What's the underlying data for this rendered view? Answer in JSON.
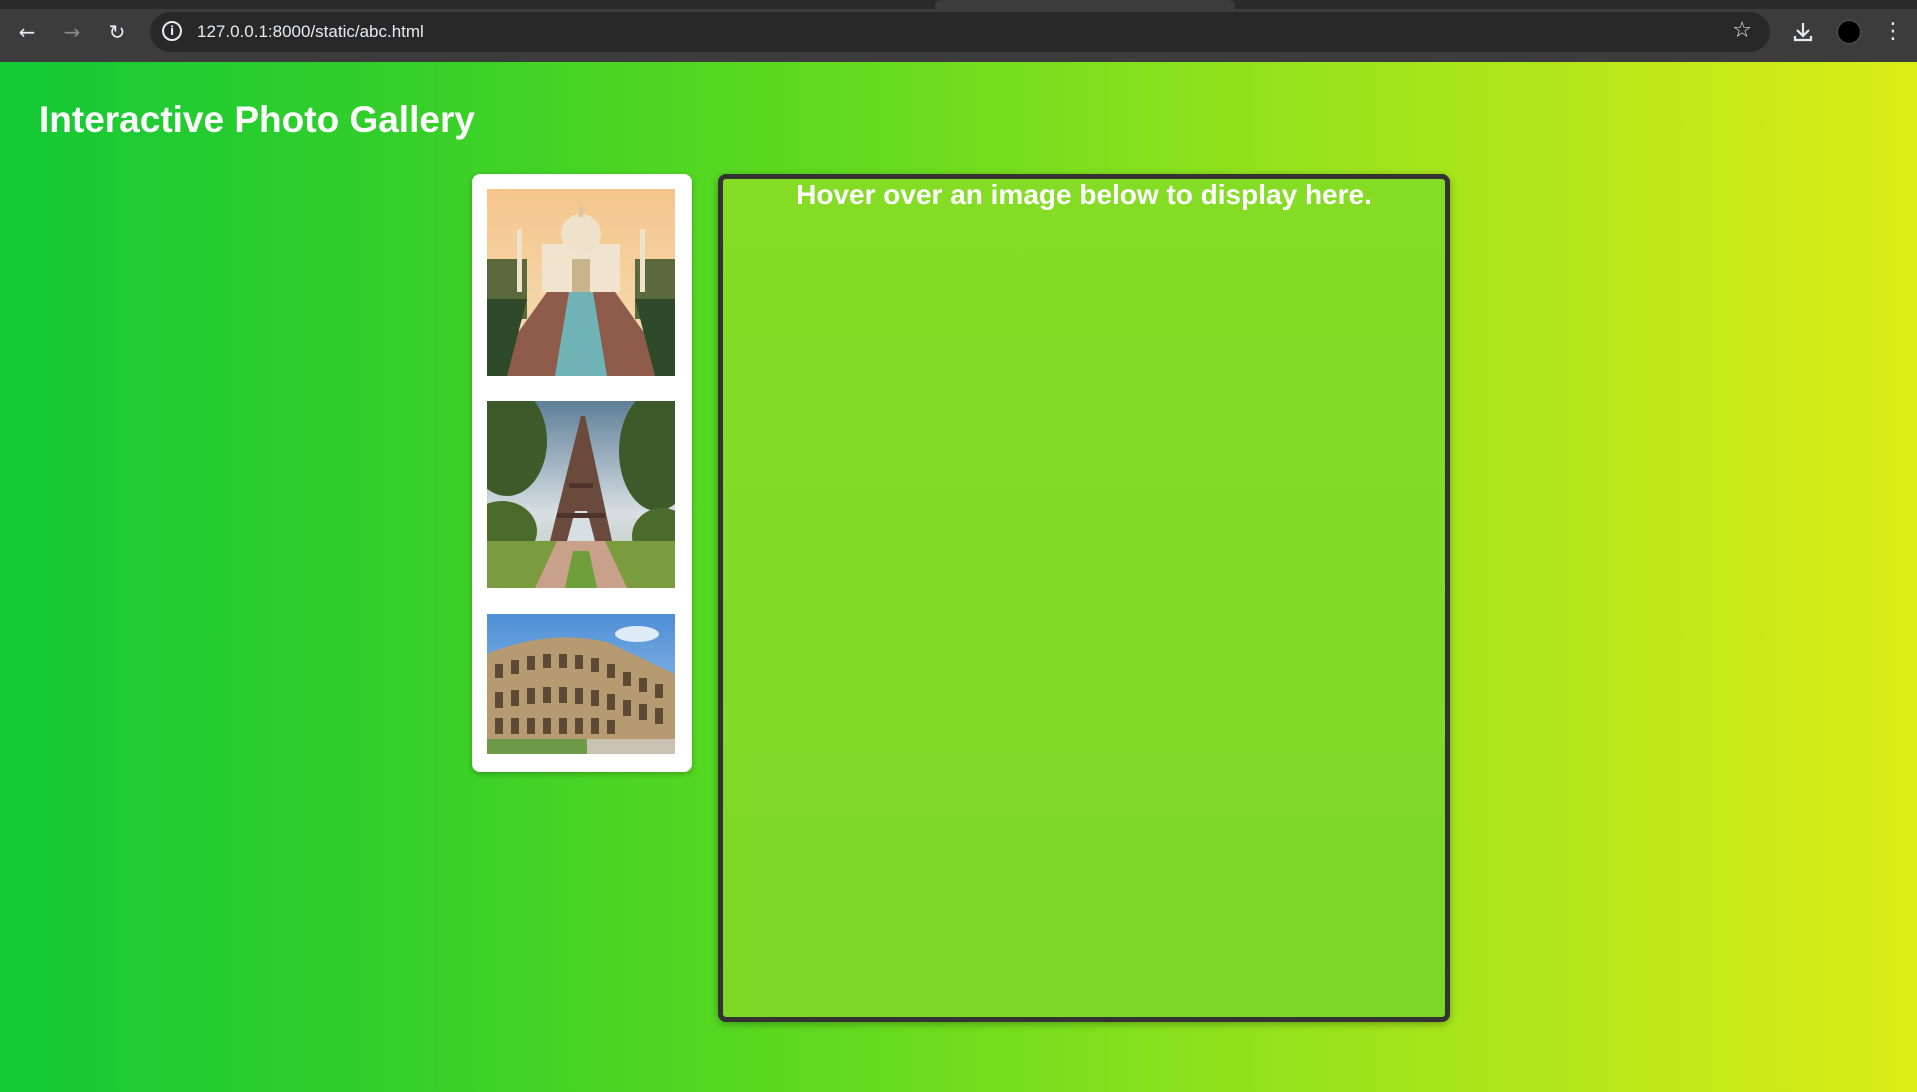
{
  "browser": {
    "url": "127.0.0.1:8000/static/abc.html",
    "icons": [
      "back-icon",
      "forward-icon",
      "reload-icon",
      "site-info-icon",
      "bookmark-star-icon",
      "download-icon",
      "profile-avatar",
      "menu-dots-icon"
    ]
  },
  "page": {
    "title": "Interactive Photo Gallery",
    "display_text": "Hover over an image below to display here.",
    "thumbnails": [
      {
        "subject": "Taj Mahal"
      },
      {
        "subject": "Eiffel Tower"
      },
      {
        "subject": "Colosseum"
      }
    ],
    "colors": {
      "gradient_start": "#13c936",
      "gradient_end": "#dced15",
      "display_border": "#333333",
      "title": "#ffffff"
    }
  }
}
